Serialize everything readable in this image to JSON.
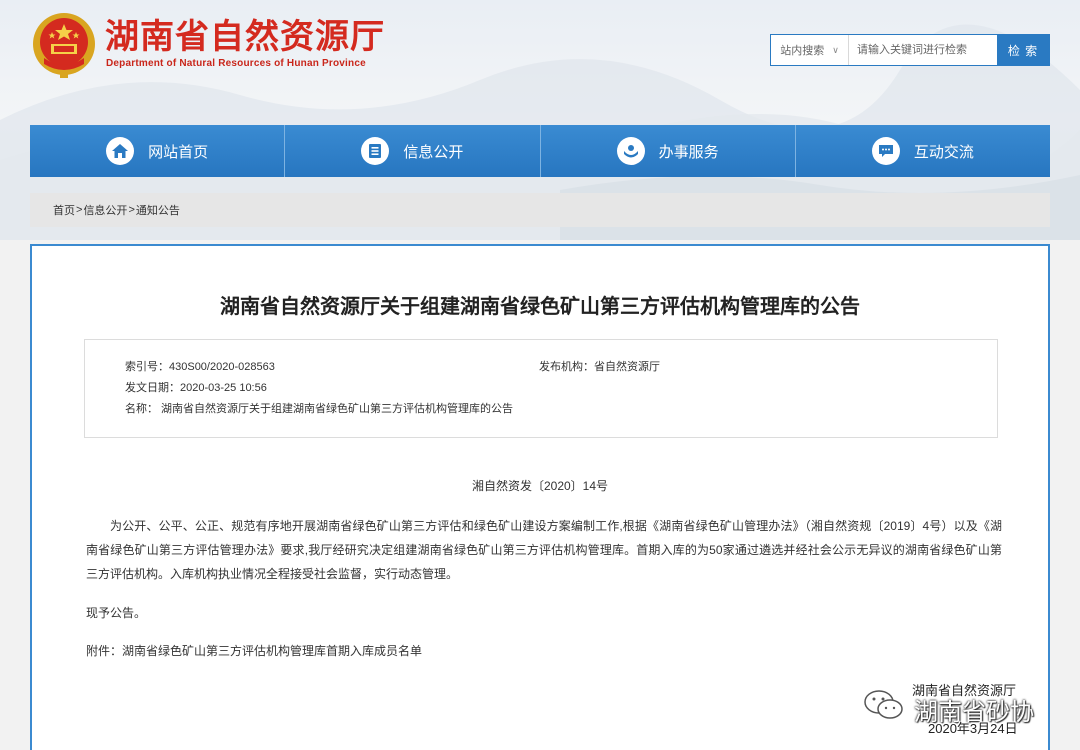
{
  "header": {
    "title": "湖南省自然资源厅",
    "subtitle": "Department of Natural Resources of Hunan Province"
  },
  "search": {
    "scope_label": "站内搜索",
    "placeholder": "请输入关键词进行检索",
    "button_label": "检 索"
  },
  "nav": {
    "items": [
      {
        "label": "网站首页",
        "icon": "home-icon"
      },
      {
        "label": "信息公开",
        "icon": "document-list-icon"
      },
      {
        "label": "办事服务",
        "icon": "service-hands-icon"
      },
      {
        "label": "互动交流",
        "icon": "chat-bubble-icon"
      }
    ]
  },
  "breadcrumb": {
    "items": [
      "首页",
      "信息公开",
      "通知公告"
    ],
    "separator": ">"
  },
  "article": {
    "title": "湖南省自然资源厅关于组建湖南省绿色矿山第三方评估机构管理库的公告",
    "meta": {
      "index_no": "索引号：430S00/2020-028563",
      "publisher": "发布机构：省自然资源厅",
      "date": "发文日期：2020-03-25 10:56",
      "name": "名称： 湖南省自然资源厅关于组建湖南省绿色矿山第三方评估机构管理库的公告"
    },
    "doc_number": "湘自然资发〔2020〕14号",
    "body": "为公开、公平、公正、规范有序地开展湖南省绿色矿山第三方评估和绿色矿山建设方案编制工作,根据《湖南省绿色矿山管理办法》（湘自然资规〔2019〕4号）以及《湖南省绿色矿山第三方评估管理办法》要求,我厅经研究决定组建湖南省绿色矿山第三方评估机构管理库。首期入库的为50家通过遴选并经社会公示无异议的湖南省绿色矿山第三方评估机构。入库机构执业情况全程接受社会监督，实行动态管理。",
    "closing": "现予公告。",
    "attachment": "附件：湖南省绿色矿山第三方评估机构管理库首期入库成员名单"
  },
  "watermark": {
    "source": "湖南省自然资源厅",
    "brand": "湖南省砂协",
    "date": "2020年3月24日"
  },
  "colors": {
    "brand_red": "#d42a1f",
    "nav_blue": "#2a7ac2"
  }
}
